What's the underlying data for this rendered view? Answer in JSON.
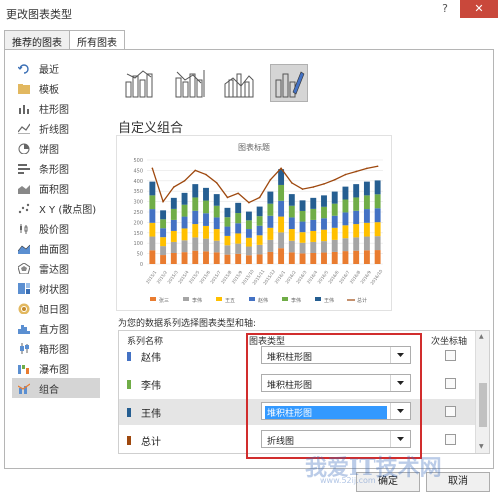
{
  "window": {
    "title": "更改图表类型",
    "help": "?",
    "close": "✕"
  },
  "tabs": [
    {
      "label": "推荐的图表"
    },
    {
      "label": "所有图表"
    }
  ],
  "sidebar": {
    "items": [
      {
        "label": "最近",
        "icon": "recent-icon"
      },
      {
        "label": "模板",
        "icon": "folder-icon"
      },
      {
        "label": "柱形图",
        "icon": "column-chart-icon"
      },
      {
        "label": "折线图",
        "icon": "line-chart-icon"
      },
      {
        "label": "饼图",
        "icon": "pie-chart-icon"
      },
      {
        "label": "条形图",
        "icon": "bar-chart-icon"
      },
      {
        "label": "面积图",
        "icon": "area-chart-icon"
      },
      {
        "label": "X Y (散点图)",
        "icon": "scatter-chart-icon"
      },
      {
        "label": "股价图",
        "icon": "stock-chart-icon"
      },
      {
        "label": "曲面图",
        "icon": "surface-chart-icon"
      },
      {
        "label": "雷达图",
        "icon": "radar-chart-icon"
      },
      {
        "label": "树状图",
        "icon": "treemap-chart-icon"
      },
      {
        "label": "旭日图",
        "icon": "sunburst-chart-icon"
      },
      {
        "label": "直方图",
        "icon": "histogram-chart-icon"
      },
      {
        "label": "箱形图",
        "icon": "box-whisker-chart-icon"
      },
      {
        "label": "瀑布图",
        "icon": "waterfall-chart-icon"
      },
      {
        "label": "组合",
        "icon": "combo-chart-icon"
      }
    ],
    "active_index": 16
  },
  "combo_subtypes": [
    "clustered-column-line-icon",
    "clustered-column-line-secondary-icon",
    "stacked-area-column-icon",
    "custom-combination-icon"
  ],
  "section_title": "自定义组合",
  "chart_preview": {
    "title": "图表标题",
    "colors": [
      "#e97c30",
      "#a5a5a5",
      "#ffc000",
      "#4472c4",
      "#70ad47",
      "#255e91",
      "#9e480e"
    ]
  },
  "chart_data": {
    "type": "bar",
    "title": "图表标题",
    "xlabel": "",
    "ylabel": "",
    "ylim": [
      0,
      500
    ],
    "yticks": [
      0,
      50,
      100,
      150,
      200,
      250,
      300,
      350,
      400,
      450,
      500
    ],
    "categories": [
      "2015/1",
      "2015/2",
      "2015/3",
      "2015/4",
      "2015/5",
      "2015/6",
      "2015/7",
      "2015/8",
      "2015/9",
      "2015/10",
      "2015/11",
      "2015/12",
      "2016/1",
      "2016/2",
      "2016/3",
      "2016/4",
      "2016/5",
      "2016/6",
      "2016/7",
      "2016/8",
      "2016/9",
      "2016/10"
    ],
    "series": [
      {
        "name": "张三",
        "kind": "stacked-column",
        "values": [
          66,
          43,
          53,
          57,
          64,
          61,
          56,
          45,
          49,
          42,
          46,
          58,
          76,
          56,
          51,
          53,
          55,
          58,
          62,
          64,
          66,
          67
        ]
      },
      {
        "name": "李伟",
        "kind": "stacked-column",
        "values": [
          66,
          43,
          53,
          57,
          64,
          61,
          56,
          45,
          49,
          42,
          46,
          58,
          76,
          56,
          51,
          53,
          55,
          58,
          62,
          64,
          66,
          67
        ]
      },
      {
        "name": "王五",
        "kind": "stacked-column",
        "values": [
          66,
          43,
          53,
          57,
          64,
          61,
          56,
          45,
          49,
          42,
          46,
          58,
          76,
          56,
          51,
          53,
          55,
          58,
          62,
          64,
          66,
          67
        ]
      },
      {
        "name": "赵伟",
        "kind": "stacked-column",
        "values": [
          66,
          43,
          53,
          57,
          64,
          61,
          56,
          45,
          49,
          42,
          46,
          58,
          76,
          56,
          51,
          53,
          55,
          58,
          62,
          64,
          66,
          67
        ]
      },
      {
        "name": "李伟",
        "kind": "stacked-column",
        "values": [
          66,
          43,
          53,
          57,
          64,
          61,
          56,
          45,
          49,
          42,
          46,
          58,
          76,
          56,
          51,
          53,
          55,
          58,
          62,
          64,
          66,
          67
        ]
      },
      {
        "name": "王伟",
        "kind": "stacked-column",
        "values": [
          66,
          43,
          53,
          57,
          64,
          61,
          56,
          45,
          49,
          42,
          46,
          58,
          76,
          56,
          51,
          53,
          55,
          58,
          62,
          64,
          66,
          67
        ]
      },
      {
        "name": "总计",
        "kind": "line",
        "values": [
          460,
          300,
          370,
          400,
          450,
          430,
          390,
          320,
          340,
          295,
          320,
          405,
          460,
          390,
          360,
          370,
          385,
          405,
          430,
          445,
          460,
          470
        ]
      }
    ],
    "legend": "bottom",
    "grid": true
  },
  "series_hint": "为您的数据系列选择图表类型和轴:",
  "series_table": {
    "headers": {
      "name": "系列名称",
      "type": "图表类型",
      "axis": "次坐标轴"
    },
    "rows": [
      {
        "name": "赵伟",
        "color": "#4472c4",
        "type": "堆积柱形图",
        "secondary": false,
        "selected": false
      },
      {
        "name": "李伟",
        "color": "#70ad47",
        "type": "堆积柱形图",
        "secondary": false,
        "selected": false
      },
      {
        "name": "王伟",
        "color": "#255e91",
        "type": "堆积柱形图",
        "secondary": false,
        "selected": true
      },
      {
        "name": "总计",
        "color": "#9e480e",
        "type": "折线图",
        "secondary": false,
        "selected": false
      }
    ]
  },
  "buttons": {
    "ok": "确定",
    "cancel": "取消"
  },
  "watermark": {
    "text": "我爱IT技术网",
    "url": "www.52ij.com"
  }
}
